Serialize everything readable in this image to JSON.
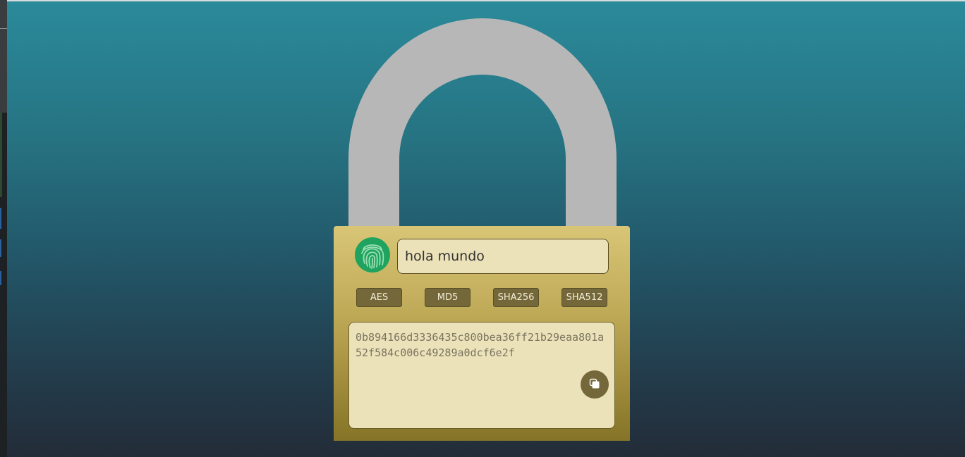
{
  "colors": {
    "shackle": "#b7b7b7",
    "lock_body": "#bfaa58",
    "fingerprint_bg": "#1fa35f",
    "button_bg": "#74683a",
    "field_bg": "#ece2b9"
  },
  "icons": {
    "fingerprint": "fingerprint-icon",
    "copy": "copy-icon"
  },
  "input": {
    "value": "hola mundo",
    "placeholder": ""
  },
  "algorithms": [
    {
      "label": "AES"
    },
    {
      "label": "MD5"
    },
    {
      "label": "SHA256"
    },
    {
      "label": "SHA512"
    }
  ],
  "output": {
    "hash": "0b894166d3336435c800bea36ff21b29eaa801a52f584c006c49289a0dcf6e2f"
  }
}
